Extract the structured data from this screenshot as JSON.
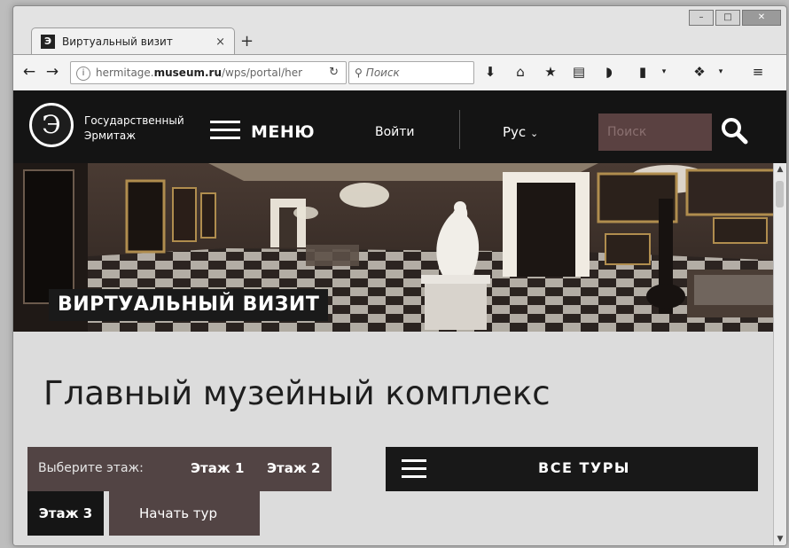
{
  "browser": {
    "tab_title": "Виртуальный визит",
    "favicon_letter": "Э",
    "tab_close": "×",
    "new_tab": "+",
    "url_prefix": "hermitage.",
    "url_host": "museum.ru",
    "url_path": "/wps/portal/her",
    "search_placeholder": "Поиск"
  },
  "site": {
    "logo_line1": "Государственный",
    "logo_line2": "Эрмитаж",
    "menu_label": "МЕНЮ",
    "login_label": "Войти",
    "language_label": "Рус",
    "search_placeholder": "Поиск"
  },
  "hero": {
    "badge": "ВИРТУАЛЬНЫЙ ВИЗИТ"
  },
  "main": {
    "title": "Главный музейный комплекс",
    "floor_prompt": "Выберите этаж:",
    "floors": [
      "Этаж 1",
      "Этаж 2",
      "Этаж 3"
    ],
    "start_tour": "Начать тур",
    "all_tours": "ВСЕ ТУРЫ"
  },
  "colors": {
    "header_bg": "#141414",
    "panel_brown": "#524444",
    "search_bg": "#5a4141"
  }
}
